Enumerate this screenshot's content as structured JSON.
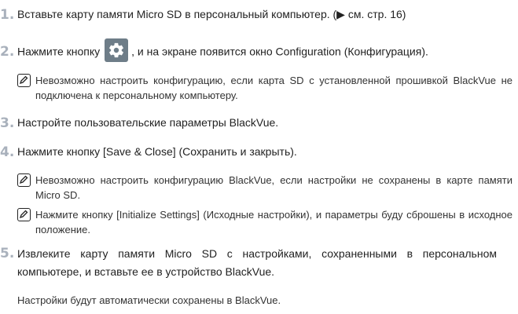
{
  "steps": [
    {
      "num": "1.",
      "text": "Вставьте карту памяти Micro SD в персональный компьютер. (▶ см. стр. 16)"
    },
    {
      "num": "2.",
      "text_before": "Нажмите кнопку",
      "text_after": ", и на экране появится окно Configuration (Конфигурация).",
      "button_icon": "gear-icon"
    },
    {
      "num": "3.",
      "text": "Настройте пользовательские параметры BlackVue."
    },
    {
      "num": "4.",
      "text": "Нажмите кнопку [Save & Close] (Сохранить и закрыть)."
    },
    {
      "num": "5.",
      "text": "Извлеките карту памяти Micro SD с настройками, сохраненными в персональном компьютере, и вставьте ее в устройство BlackVue."
    }
  ],
  "notes": [
    {
      "icon": "note-pencil-icon",
      "text": "Невозможно настроить конфигурацию, если карта SD с установленной прошивкой BlackVue не подключена к персональному компьютеру."
    },
    {
      "icon": "note-pencil-icon",
      "text": "Невозможно настроить конфигурацию BlackVue, если настройки не сохранены в карте памяти Micro SD."
    },
    {
      "icon": "note-pencil-icon",
      "text": "Нажмите кнопку [Initialize Settings] (Исходные настройки), и параметры буду сброшены в исходное положение."
    }
  ],
  "closing_text": "Настройки будут автоматически сохранены в BlackVue.",
  "colors": {
    "step_number": "#a9b1bc",
    "gear_button_bg": "#6e7d88"
  }
}
